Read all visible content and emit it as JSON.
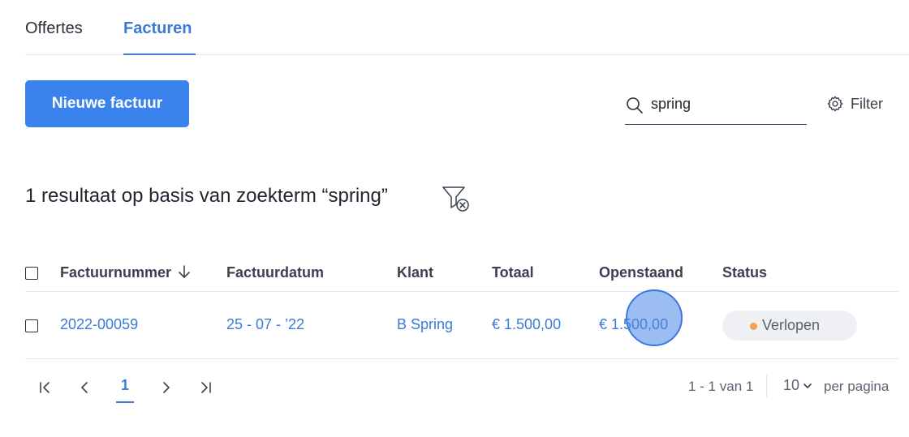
{
  "tabs": [
    {
      "label": "Offertes",
      "active": false
    },
    {
      "label": "Facturen",
      "active": true
    }
  ],
  "toolbar": {
    "new_invoice_label": "Nieuwe factuur",
    "search_value": "spring",
    "filter_label": "Filter"
  },
  "results": {
    "title": "1 resultaat op basis van zoekterm “spring”"
  },
  "table": {
    "columns": [
      "Factuurnummer",
      "Factuurdatum",
      "Klant",
      "Totaal",
      "Openstaand",
      "Status"
    ],
    "sort_column": "Factuurnummer",
    "sort_direction": "descending",
    "rows": [
      {
        "factuurnummer": "2022-00059",
        "factuurdatum": "25 - 07 - ’22",
        "klant": "B Spring",
        "totaal": "€ 1.500,00",
        "openstaand": "€ 1.500,00",
        "status": "Verlopen",
        "status_color": "#f6a04d"
      }
    ]
  },
  "pagination": {
    "current_page": "1",
    "range_text": "1 - 1 van 1",
    "per_page_value": "10",
    "per_page_label": "per pagina"
  },
  "colors": {
    "accent": "#3a7bd5",
    "button": "#3a82ee",
    "status_expired_dot": "#f6a04d"
  },
  "icons": [
    "search-icon",
    "gear-icon",
    "clear-filter-icon",
    "sort-down-arrow-icon",
    "first-page-icon",
    "prev-page-icon",
    "next-page-icon",
    "last-page-icon",
    "chevron-down-icon"
  ]
}
